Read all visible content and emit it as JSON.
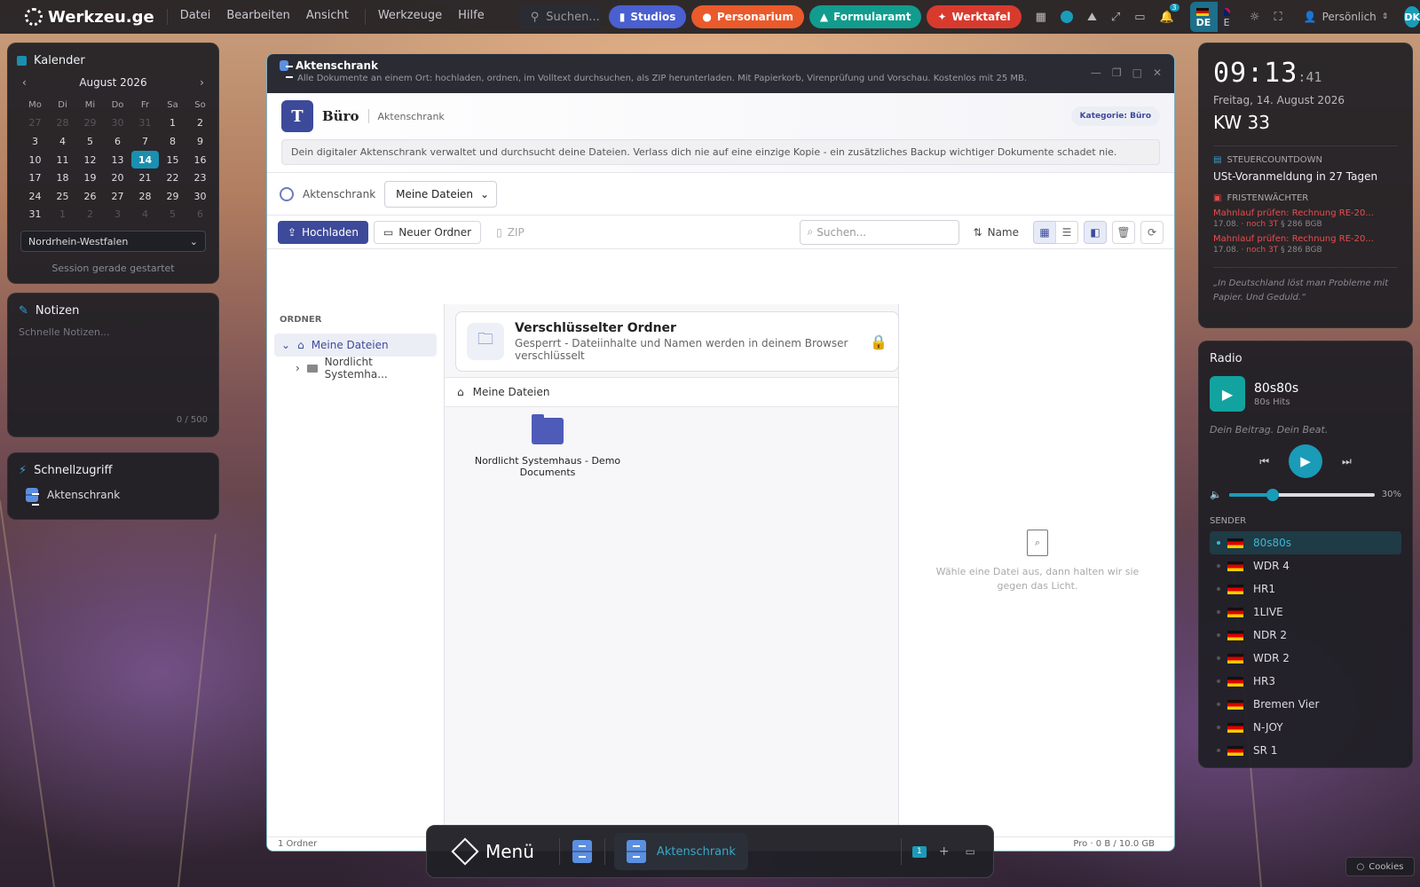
{
  "topbar": {
    "brand": "Werkzeu.ge",
    "menus": [
      "Datei",
      "Bearbeiten",
      "Ansicht",
      "Werkzeuge",
      "Hilfe"
    ],
    "search_placeholder": "Suchen...",
    "pills": [
      {
        "label": "Studios",
        "color": "#4a5fd0"
      },
      {
        "label": "Personarium",
        "color": "#ea5a2b"
      },
      {
        "label": "Formularamt",
        "color": "#119c8e"
      },
      {
        "label": "Werktafel",
        "color": "#d93a2e"
      }
    ],
    "notifications": "3",
    "lang_de": "DE",
    "lang_en": "EN",
    "profile": "Persönlich",
    "avatar": "DK"
  },
  "calendar": {
    "title": "Kalender",
    "month": "August 2026",
    "weekdays": [
      "Mo",
      "Di",
      "Mi",
      "Do",
      "Fr",
      "Sa",
      "So"
    ],
    "days": [
      "27",
      "28",
      "29",
      "30",
      "31",
      "1",
      "2",
      "3",
      "4",
      "5",
      "6",
      "7",
      "8",
      "9",
      "10",
      "11",
      "12",
      "13",
      "14",
      "15",
      "16",
      "17",
      "18",
      "19",
      "20",
      "21",
      "22",
      "23",
      "24",
      "25",
      "26",
      "27",
      "28",
      "29",
      "30",
      "31",
      "1",
      "2",
      "3",
      "4",
      "5",
      "6"
    ],
    "muted_leading": 5,
    "muted_trailing": 6,
    "today": "14",
    "state": "Nordrhein-Westfalen",
    "session": "Session gerade gestartet"
  },
  "notes": {
    "title": "Notizen",
    "placeholder": "Schnelle Notizen...",
    "counter": "0 / 500"
  },
  "quick": {
    "title": "Schnellzugriff",
    "item": "Aktenschrank"
  },
  "window": {
    "title": "Aktenschrank",
    "subtitle": "Alle Dokumente an einem Ort: hochladen, ordnen, im Volltext durchsuchen, als ZIP herunterladen. Mit Papierkorb, Virenprüfung und Vorschau. Kostenlos mit 25 MB.",
    "org_badge": "T",
    "org": "Büro",
    "org_sub": "Aktenschrank",
    "category": "Kategorie: Büro",
    "info": "Dein digitaler Aktenschrank verwaltet und durchsucht deine Dateien. Verlass dich nie auf eine einzige Kopie - ein zusätzliches Backup wichtiger Dokumente schadet nie.",
    "scope_label": "Aktenschrank",
    "scope_value": "Meine Dateien",
    "upload": "Hochladen",
    "new_folder": "Neuer Ordner",
    "zip": "ZIP",
    "search_placeholder": "Suchen...",
    "sort": "Name",
    "tree_header": "ORDNER",
    "tree_root": "Meine Dateien",
    "tree_child": "Nordlicht Systemha...",
    "enc_title": "Verschlüsselter Ordner",
    "enc_sub": "Gesperrt - Dateiinhalte und Namen werden in deinem Browser verschlüsselt",
    "breadcrumb": "Meine Dateien",
    "folder_name": "Nordlicht Systemhaus - Demo Documents",
    "preview_hint": "Wähle eine Datei aus, dann halten wir sie gegen das Licht.",
    "status_left": "1 Ordner",
    "status_right": "Pro · 0 B / 10.0 GB"
  },
  "clock": {
    "hm": "09:13",
    "sec": ":41",
    "date": "Freitag, 14. August 2026",
    "week": "KW 33",
    "tax_label": "STEUERCOUNTDOWN",
    "tax_text": "USt-Voranmeldung in 27 Tagen",
    "deadline_label": "FRISTENWÄCHTER",
    "deadlines": [
      {
        "title": "Mahnlauf prüfen: Rechnung RE-20...",
        "date": "17.08.",
        "left": "noch 3T",
        "law": "§ 286 BGB"
      },
      {
        "title": "Mahnlauf prüfen: Rechnung RE-20...",
        "date": "17.08.",
        "left": "noch 3T",
        "law": "§ 286 BGB"
      }
    ],
    "quote": "„In Deutschland löst man Probleme mit Papier. Und Geduld.“"
  },
  "radio": {
    "title": "Radio",
    "now": "80s80s",
    "now_sub": "80s Hits",
    "slogan": "Dein Beitrag. Dein Beat.",
    "volume": 30,
    "volume_label": "30%",
    "stations_label": "SENDER",
    "stations": [
      "80s80s",
      "WDR 4",
      "HR1",
      "1LIVE",
      "NDR 2",
      "WDR 2",
      "HR3",
      "Bremen Vier",
      "N-JOY",
      "SR 1"
    ],
    "active": "80s80s"
  },
  "dock": {
    "menu": "Menü",
    "app": "Aktenschrank",
    "workspace": "1"
  },
  "cookies": "Cookies"
}
